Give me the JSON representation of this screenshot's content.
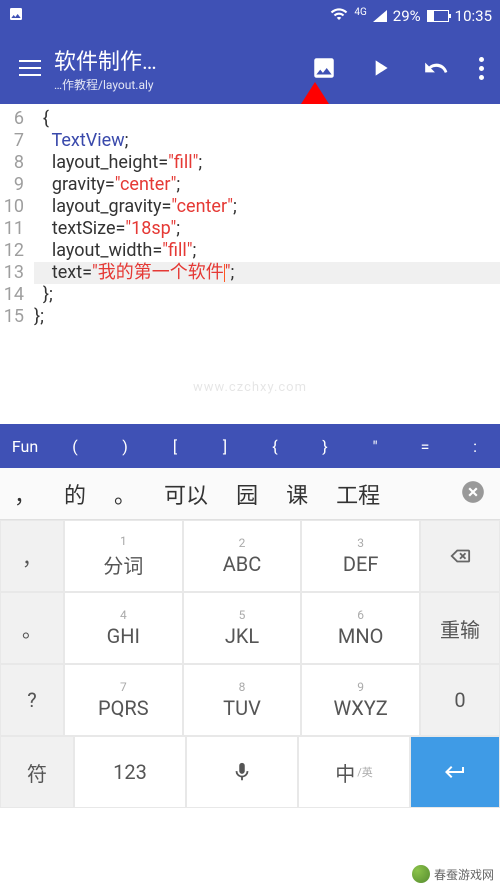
{
  "status": {
    "battery_pct": "29%",
    "time": "10:35",
    "net_label": "4G"
  },
  "appbar": {
    "title": "软件制作…",
    "subtitle": "…作教程/layout.aly"
  },
  "code_lines": [
    {
      "n": "6",
      "indent": 2,
      "segs": [
        {
          "t": "{",
          "c": ""
        }
      ]
    },
    {
      "n": "7",
      "indent": 4,
      "segs": [
        {
          "t": "TextView",
          "c": "kw"
        },
        {
          "t": ";",
          "c": ""
        }
      ]
    },
    {
      "n": "8",
      "indent": 4,
      "segs": [
        {
          "t": "layout_height=",
          "c": ""
        },
        {
          "t": "\"fill\"",
          "c": "str"
        },
        {
          "t": ";",
          "c": ""
        }
      ]
    },
    {
      "n": "9",
      "indent": 4,
      "segs": [
        {
          "t": "gravity=",
          "c": ""
        },
        {
          "t": "\"center\"",
          "c": "str"
        },
        {
          "t": ";",
          "c": ""
        }
      ]
    },
    {
      "n": "10",
      "indent": 4,
      "segs": [
        {
          "t": "layout_gravity=",
          "c": ""
        },
        {
          "t": "\"center\"",
          "c": "str"
        },
        {
          "t": ";",
          "c": ""
        }
      ]
    },
    {
      "n": "11",
      "indent": 4,
      "segs": [
        {
          "t": "textSize=",
          "c": ""
        },
        {
          "t": "\"18sp\"",
          "c": "str"
        },
        {
          "t": ";",
          "c": ""
        }
      ]
    },
    {
      "n": "12",
      "indent": 4,
      "segs": [
        {
          "t": "layout_width=",
          "c": ""
        },
        {
          "t": "\"fill\"",
          "c": "str"
        },
        {
          "t": ";",
          "c": ""
        }
      ]
    },
    {
      "n": "13",
      "indent": 4,
      "hl": true,
      "caret": true,
      "segs": [
        {
          "t": "text=",
          "c": ""
        },
        {
          "t": "\"我的第一个软件\"",
          "c": "str"
        },
        {
          "t": ";",
          "c": ""
        }
      ]
    },
    {
      "n": "14",
      "indent": 2,
      "segs": [
        {
          "t": "};",
          "c": ""
        }
      ]
    },
    {
      "n": "15",
      "indent": 0,
      "segs": [
        {
          "t": "};",
          "c": ""
        }
      ]
    }
  ],
  "symbols": [
    "Fun",
    "(",
    ")",
    "[",
    "]",
    "{",
    "}",
    "\"",
    "=",
    ":"
  ],
  "candidates": [
    "，",
    "的",
    "。",
    "可以",
    "园",
    "课",
    "工程"
  ],
  "keypad": {
    "rows": [
      {
        "side_left": "，",
        "keys": [
          {
            "num": "1",
            "lbl": "分词"
          },
          {
            "num": "2",
            "lbl": "ABC"
          },
          {
            "num": "3",
            "lbl": "DEF"
          }
        ],
        "side_right": "bksp"
      },
      {
        "side_left": "。",
        "keys": [
          {
            "num": "4",
            "lbl": "GHI"
          },
          {
            "num": "5",
            "lbl": "JKL"
          },
          {
            "num": "6",
            "lbl": "MNO"
          }
        ],
        "side_right": "重输"
      },
      {
        "side_left": "?",
        "keys": [
          {
            "num": "7",
            "lbl": "PQRS"
          },
          {
            "num": "8",
            "lbl": "TUV"
          },
          {
            "num": "9",
            "lbl": "WXYZ"
          }
        ],
        "side_right": "0"
      }
    ],
    "bottom": {
      "l1": "符",
      "l2": "123",
      "mic": "mic",
      "zhong": "中",
      "enter": "enter"
    }
  },
  "watermark": "www.czchxy.com",
  "logo_text": "春蚕游戏网"
}
